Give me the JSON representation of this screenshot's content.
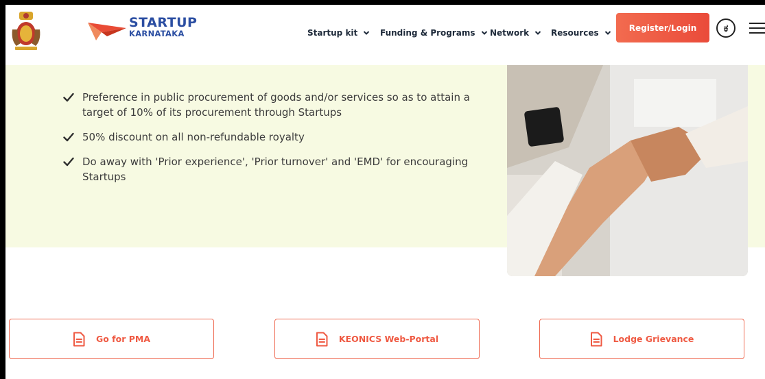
{
  "brand": {
    "line1": "STARTUP",
    "line2": "KARNATAKA",
    "color": "#2b4ea2",
    "accent": "#ef5a43"
  },
  "nav": {
    "items": [
      {
        "label": "Startup kit"
      },
      {
        "label": "Funding & Programs"
      },
      {
        "label": "Network"
      },
      {
        "label": "Resources"
      }
    ],
    "register_label": "Register/Login",
    "language_glyph": "ಕ"
  },
  "benefits": [
    {
      "text": "Preference in public procurement of goods and/or services so as to attain a target of 10% of its procurement through Startups"
    },
    {
      "text": "50% discount on all non-refundable royalty"
    },
    {
      "text": "Do away with 'Prior experience', 'Prior turnover' and 'EMD' for encouraging Startups"
    }
  ],
  "actions": [
    {
      "label": "Go for PMA",
      "icon": "document-icon"
    },
    {
      "label": "KEONICS Web-Portal",
      "icon": "document-icon"
    },
    {
      "label": "Lodge Grievance",
      "icon": "document-icon"
    }
  ],
  "colors": {
    "band": "#f7fae2",
    "button_border": "#ef6b53"
  }
}
